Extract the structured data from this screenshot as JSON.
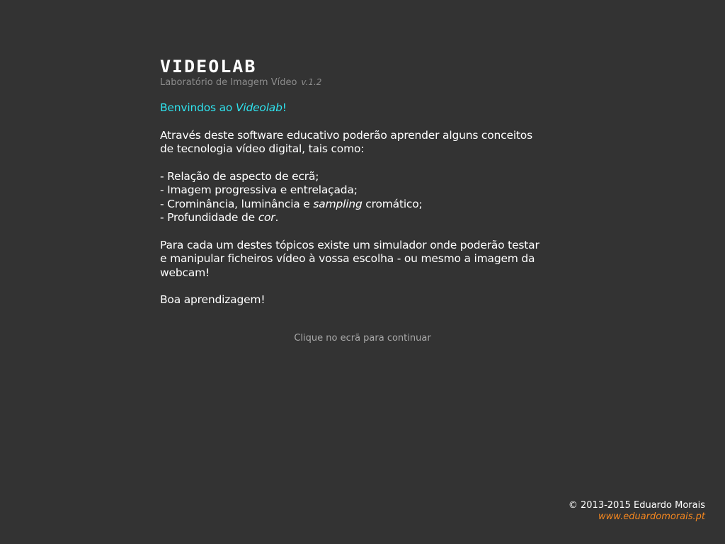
{
  "header": {
    "logo": "VIDEOLAB",
    "subtitle": "Laboratório de Imagem Vídeo",
    "version": "v.1.2"
  },
  "content": {
    "welcome_prefix": "Benvindos ao ",
    "welcome_name": "Videolab",
    "welcome_suffix": "!",
    "intro": "Através deste software educativo poderão aprender alguns conceitos de tecnologia vídeo digital, tais como:",
    "topics": {
      "t1": "- Relação de aspecto de ecrã;",
      "t2": "- Imagem progressiva e entrelaçada;",
      "t3_a": "- Crominância, luminância e ",
      "t3_em": "sampling",
      "t3_b": " cromático;",
      "t4_a": "- Profundidade de ",
      "t4_em": "cor",
      "t4_b": "."
    },
    "simulator": "Para cada um destes tópicos existe um simulador onde poderão testar e manipular ficheiros vídeo à vossa escolha - ou mesmo a imagem da webcam!",
    "closing": "Boa aprendizagem!"
  },
  "continue_hint": "Clique no ecrã para continuar",
  "footer": {
    "copyright": "© 2013-2015 Eduardo Morais",
    "website": "www.eduardomorais.pt"
  },
  "colors": {
    "background": "#333333",
    "welcome": "#2fe3ee",
    "link": "#f5871f",
    "muted": "#8c8c8c"
  }
}
